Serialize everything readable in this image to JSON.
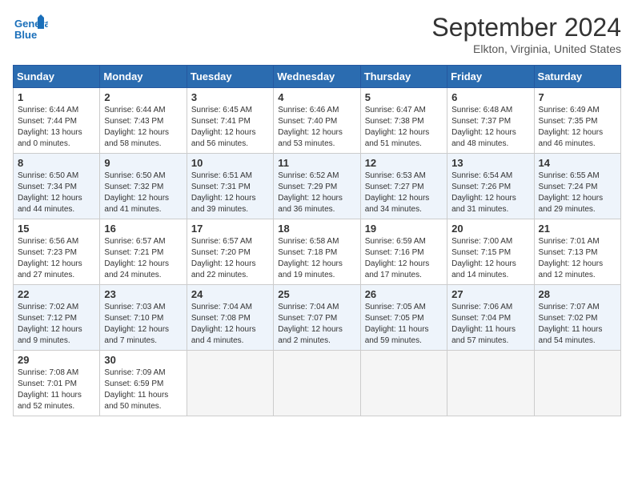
{
  "header": {
    "logo_line1": "General",
    "logo_line2": "Blue",
    "month": "September 2024",
    "location": "Elkton, Virginia, United States"
  },
  "days_of_week": [
    "Sunday",
    "Monday",
    "Tuesday",
    "Wednesday",
    "Thursday",
    "Friday",
    "Saturday"
  ],
  "weeks": [
    [
      {
        "day": 1,
        "info": "Sunrise: 6:44 AM\nSunset: 7:44 PM\nDaylight: 13 hours\nand 0 minutes."
      },
      {
        "day": 2,
        "info": "Sunrise: 6:44 AM\nSunset: 7:43 PM\nDaylight: 12 hours\nand 58 minutes."
      },
      {
        "day": 3,
        "info": "Sunrise: 6:45 AM\nSunset: 7:41 PM\nDaylight: 12 hours\nand 56 minutes."
      },
      {
        "day": 4,
        "info": "Sunrise: 6:46 AM\nSunset: 7:40 PM\nDaylight: 12 hours\nand 53 minutes."
      },
      {
        "day": 5,
        "info": "Sunrise: 6:47 AM\nSunset: 7:38 PM\nDaylight: 12 hours\nand 51 minutes."
      },
      {
        "day": 6,
        "info": "Sunrise: 6:48 AM\nSunset: 7:37 PM\nDaylight: 12 hours\nand 48 minutes."
      },
      {
        "day": 7,
        "info": "Sunrise: 6:49 AM\nSunset: 7:35 PM\nDaylight: 12 hours\nand 46 minutes."
      }
    ],
    [
      {
        "day": 8,
        "info": "Sunrise: 6:50 AM\nSunset: 7:34 PM\nDaylight: 12 hours\nand 44 minutes."
      },
      {
        "day": 9,
        "info": "Sunrise: 6:50 AM\nSunset: 7:32 PM\nDaylight: 12 hours\nand 41 minutes."
      },
      {
        "day": 10,
        "info": "Sunrise: 6:51 AM\nSunset: 7:31 PM\nDaylight: 12 hours\nand 39 minutes."
      },
      {
        "day": 11,
        "info": "Sunrise: 6:52 AM\nSunset: 7:29 PM\nDaylight: 12 hours\nand 36 minutes."
      },
      {
        "day": 12,
        "info": "Sunrise: 6:53 AM\nSunset: 7:27 PM\nDaylight: 12 hours\nand 34 minutes."
      },
      {
        "day": 13,
        "info": "Sunrise: 6:54 AM\nSunset: 7:26 PM\nDaylight: 12 hours\nand 31 minutes."
      },
      {
        "day": 14,
        "info": "Sunrise: 6:55 AM\nSunset: 7:24 PM\nDaylight: 12 hours\nand 29 minutes."
      }
    ],
    [
      {
        "day": 15,
        "info": "Sunrise: 6:56 AM\nSunset: 7:23 PM\nDaylight: 12 hours\nand 27 minutes."
      },
      {
        "day": 16,
        "info": "Sunrise: 6:57 AM\nSunset: 7:21 PM\nDaylight: 12 hours\nand 24 minutes."
      },
      {
        "day": 17,
        "info": "Sunrise: 6:57 AM\nSunset: 7:20 PM\nDaylight: 12 hours\nand 22 minutes."
      },
      {
        "day": 18,
        "info": "Sunrise: 6:58 AM\nSunset: 7:18 PM\nDaylight: 12 hours\nand 19 minutes."
      },
      {
        "day": 19,
        "info": "Sunrise: 6:59 AM\nSunset: 7:16 PM\nDaylight: 12 hours\nand 17 minutes."
      },
      {
        "day": 20,
        "info": "Sunrise: 7:00 AM\nSunset: 7:15 PM\nDaylight: 12 hours\nand 14 minutes."
      },
      {
        "day": 21,
        "info": "Sunrise: 7:01 AM\nSunset: 7:13 PM\nDaylight: 12 hours\nand 12 minutes."
      }
    ],
    [
      {
        "day": 22,
        "info": "Sunrise: 7:02 AM\nSunset: 7:12 PM\nDaylight: 12 hours\nand 9 minutes."
      },
      {
        "day": 23,
        "info": "Sunrise: 7:03 AM\nSunset: 7:10 PM\nDaylight: 12 hours\nand 7 minutes."
      },
      {
        "day": 24,
        "info": "Sunrise: 7:04 AM\nSunset: 7:08 PM\nDaylight: 12 hours\nand 4 minutes."
      },
      {
        "day": 25,
        "info": "Sunrise: 7:04 AM\nSunset: 7:07 PM\nDaylight: 12 hours\nand 2 minutes."
      },
      {
        "day": 26,
        "info": "Sunrise: 7:05 AM\nSunset: 7:05 PM\nDaylight: 11 hours\nand 59 minutes."
      },
      {
        "day": 27,
        "info": "Sunrise: 7:06 AM\nSunset: 7:04 PM\nDaylight: 11 hours\nand 57 minutes."
      },
      {
        "day": 28,
        "info": "Sunrise: 7:07 AM\nSunset: 7:02 PM\nDaylight: 11 hours\nand 54 minutes."
      }
    ],
    [
      {
        "day": 29,
        "info": "Sunrise: 7:08 AM\nSunset: 7:01 PM\nDaylight: 11 hours\nand 52 minutes."
      },
      {
        "day": 30,
        "info": "Sunrise: 7:09 AM\nSunset: 6:59 PM\nDaylight: 11 hours\nand 50 minutes."
      },
      null,
      null,
      null,
      null,
      null
    ]
  ]
}
